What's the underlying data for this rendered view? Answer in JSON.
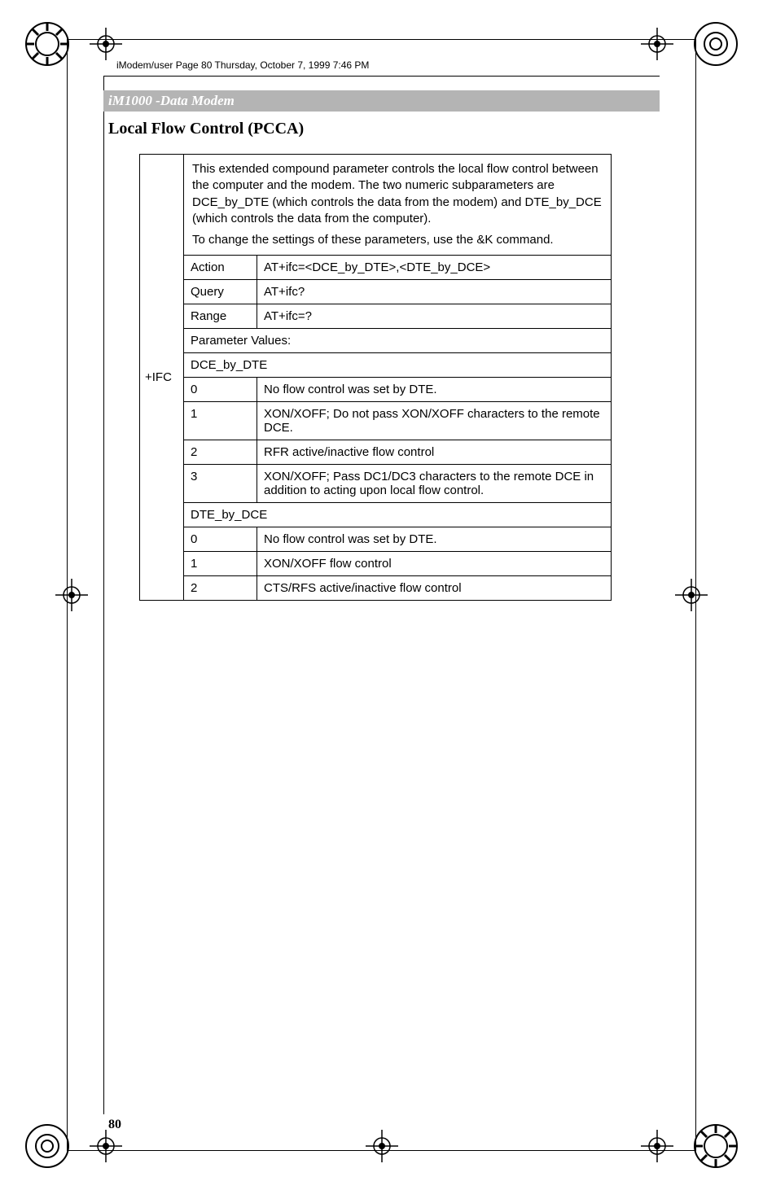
{
  "meta": {
    "header_text": "iModem/user  Page 80  Thursday, October 7, 1999  7:46 PM"
  },
  "band": {
    "title": "iM1000 -Data Modem"
  },
  "section": {
    "title": "Local Flow Control (PCCA)"
  },
  "table": {
    "command_label": "+IFC",
    "desc_p1": "This extended compound parameter controls the local flow control between the computer and the modem. The two numeric subparameters are DCE_by_DTE (which controls the data from the modem) and DTE_by_DCE (which controls the data from the computer).",
    "desc_p2": "To change the settings of these parameters, use the &K command.",
    "rows": {
      "action_label": "Action",
      "action_val": "AT+ifc=<DCE_by_DTE>,<DTE_by_DCE>",
      "query_label": "Query",
      "query_val": "AT+ifc?",
      "range_label": "Range",
      "range_val": "AT+ifc=?",
      "param_values": "Parameter Values:",
      "dce_by_dte": "DCE_by_DTE",
      "dce0_k": "0",
      "dce0_v": "No flow control was set by DTE.",
      "dce1_k": "1",
      "dce1_v": "XON/XOFF; Do not pass XON/XOFF characters to the remote DCE.",
      "dce2_k": "2",
      "dce2_v": "RFR active/inactive flow control",
      "dce3_k": "3",
      "dce3_v": "XON/XOFF; Pass DC1/DC3 characters to the remote DCE in addition to acting upon local flow control.",
      "dte_by_dce": "DTE_by_DCE",
      "dte0_k": "0",
      "dte0_v": "No flow control was set by DTE.",
      "dte1_k": "1",
      "dte1_v": "XON/XOFF flow control",
      "dte2_k": "2",
      "dte2_v": "CTS/RFS active/inactive flow control"
    }
  },
  "page": {
    "number": "80"
  }
}
